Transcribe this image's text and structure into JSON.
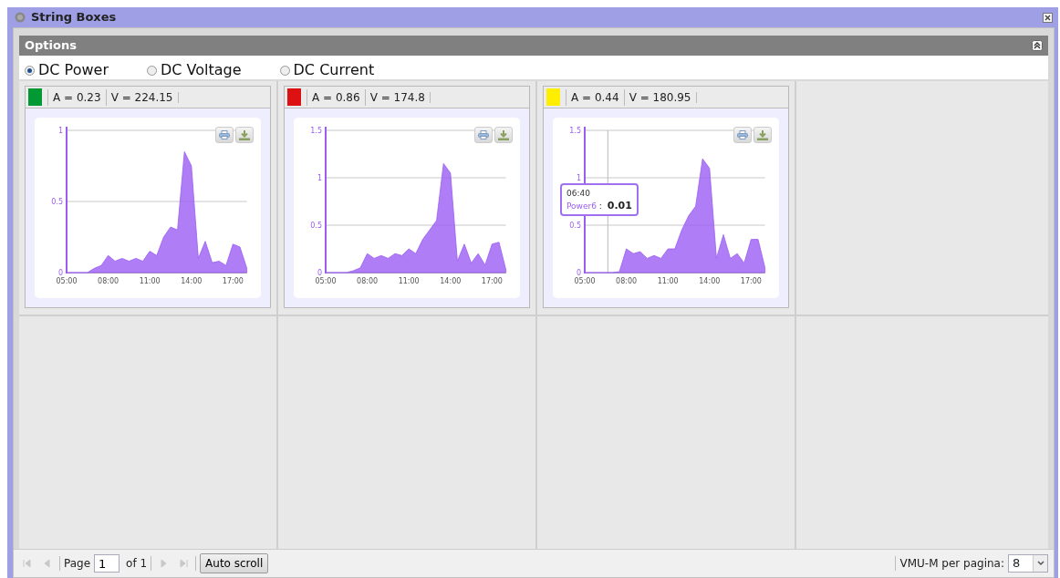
{
  "window": {
    "title": "String Boxes"
  },
  "options": {
    "title": "Options",
    "items": [
      {
        "label": "DC Power",
        "selected": true
      },
      {
        "label": "DC Voltage",
        "selected": false
      },
      {
        "label": "DC Current",
        "selected": false
      }
    ]
  },
  "string_boxes": [
    {
      "color": "#009933",
      "current": "A = 0.23",
      "voltage": "V = 224.15",
      "chart_data": {
        "type": "area",
        "xlim": [
          5,
          18
        ],
        "ylim": [
          0,
          1
        ],
        "yticks": [
          0,
          0.5,
          1
        ],
        "xticks": [
          {
            "value": 5,
            "label": "05:00"
          },
          {
            "value": 8,
            "label": "08:00"
          },
          {
            "value": 11,
            "label": "11:00"
          },
          {
            "value": 14,
            "label": "14:00"
          },
          {
            "value": 17,
            "label": "17:00"
          }
        ],
        "x": [
          5,
          5.5,
          6,
          6.5,
          7,
          7.5,
          8,
          8.5,
          9,
          9.5,
          10,
          10.5,
          11,
          11.5,
          12,
          12.5,
          13,
          13.5,
          14,
          14.5,
          15,
          15.5,
          16,
          16.5,
          17,
          17.5,
          18
        ],
        "series": [
          {
            "color": "#9b5cf2",
            "values": [
              0,
              0,
              0,
              0,
              0.03,
              0.05,
              0.12,
              0.08,
              0.1,
              0.08,
              0.1,
              0.08,
              0.15,
              0.12,
              0.25,
              0.32,
              0.3,
              0.85,
              0.75,
              0.1,
              0.22,
              0.07,
              0.08,
              0.05,
              0.2,
              0.18,
              0.03
            ]
          }
        ]
      }
    },
    {
      "color": "#dd1111",
      "current": "A = 0.86",
      "voltage": "V = 174.8",
      "chart_data": {
        "type": "area",
        "xlim": [
          5,
          18
        ],
        "ylim": [
          0,
          1.5
        ],
        "yticks": [
          0,
          0.5,
          1,
          1.5
        ],
        "xticks": [
          {
            "value": 5,
            "label": "05:00"
          },
          {
            "value": 8,
            "label": "08:00"
          },
          {
            "value": 11,
            "label": "11:00"
          },
          {
            "value": 14,
            "label": "14:00"
          },
          {
            "value": 17,
            "label": "17:00"
          }
        ],
        "x": [
          5,
          5.5,
          6,
          6.5,
          7,
          7.5,
          8,
          8.5,
          9,
          9.5,
          10,
          10.5,
          11,
          11.5,
          12,
          12.5,
          13,
          13.5,
          14,
          14.5,
          15,
          15.5,
          16,
          16.5,
          17,
          17.5,
          18
        ],
        "series": [
          {
            "color": "#9b5cf2",
            "values": [
              0,
              0,
              0,
              0,
              0.02,
              0.05,
              0.2,
              0.15,
              0.18,
              0.15,
              0.2,
              0.18,
              0.25,
              0.2,
              0.35,
              0.45,
              0.55,
              1.15,
              1.05,
              0.12,
              0.3,
              0.1,
              0.2,
              0.08,
              0.3,
              0.32,
              0.03
            ]
          }
        ]
      }
    },
    {
      "color": "#ffee00",
      "current": "A = 0.44",
      "voltage": "V = 180.95",
      "chart_data": {
        "type": "area",
        "xlim": [
          5,
          18
        ],
        "ylim": [
          0,
          1.5
        ],
        "yticks": [
          0,
          0.5,
          1,
          1.5
        ],
        "xticks": [
          {
            "value": 5,
            "label": "05:00"
          },
          {
            "value": 8,
            "label": "08:00"
          },
          {
            "value": 11,
            "label": "11:00"
          },
          {
            "value": 14,
            "label": "14:00"
          },
          {
            "value": 17,
            "label": "17:00"
          }
        ],
        "x": [
          5,
          5.5,
          6,
          6.5,
          7,
          7.5,
          8,
          8.5,
          9,
          9.5,
          10,
          10.5,
          11,
          11.5,
          12,
          12.5,
          13,
          13.5,
          14,
          14.5,
          15,
          15.5,
          16,
          16.5,
          17,
          17.5,
          18
        ],
        "series": [
          {
            "color": "#9b5cf2",
            "values": [
              0,
              0,
              0,
              0,
              0,
              0.01,
              0.25,
              0.2,
              0.22,
              0.15,
              0.18,
              0.15,
              0.25,
              0.25,
              0.45,
              0.6,
              0.7,
              1.2,
              1.1,
              0.15,
              0.4,
              0.15,
              0.2,
              0.1,
              0.35,
              0.35,
              0.05
            ]
          }
        ],
        "ref_lines": [
          {
            "axis": "x",
            "value": 6.667
          }
        ]
      },
      "tooltip": {
        "time": "06:40",
        "series": "Power6",
        "separator": ":",
        "value": "0.01"
      }
    }
  ],
  "pager": {
    "page_label": "Page",
    "page": "1",
    "of_label": "of 1",
    "auto_scroll": "Auto scroll",
    "per_page_label": "VMU-M per pagina:",
    "per_page": "8"
  }
}
